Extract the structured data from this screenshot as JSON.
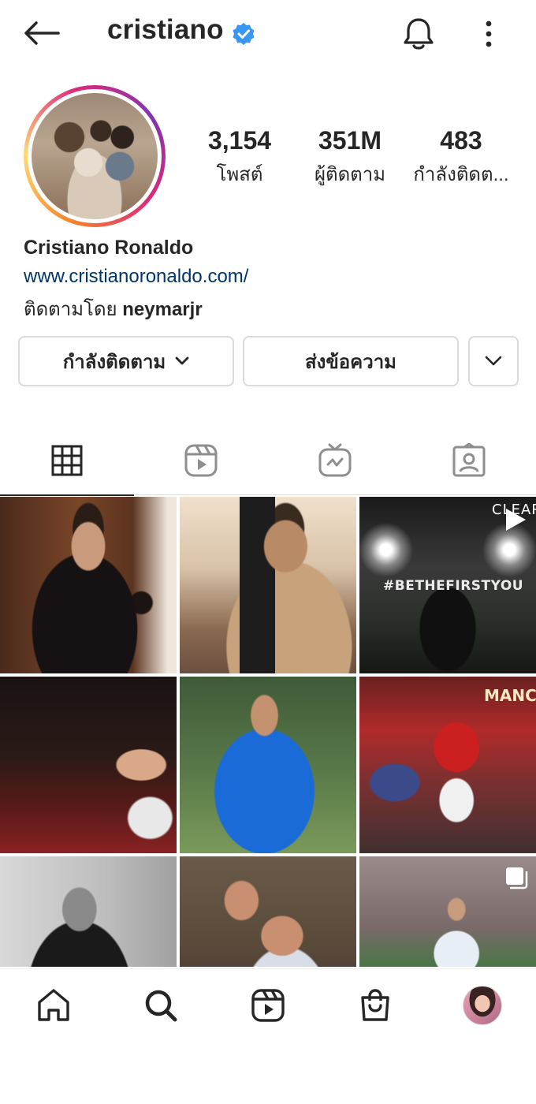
{
  "header": {
    "username": "cristiano",
    "verified": true,
    "icons": [
      "back-arrow-icon",
      "verified-badge-icon",
      "bell-icon",
      "more-vertical-icon"
    ]
  },
  "profile": {
    "stats": {
      "posts": {
        "value": "3,154",
        "label": "โพสต์"
      },
      "followers": {
        "value": "351M",
        "label": "ผู้ติดตาม"
      },
      "following": {
        "value": "483",
        "label": "กำลังติดต..."
      }
    },
    "full_name": "Cristiano Ronaldo",
    "website": "www.cristianoronaldo.com/",
    "followed_by_prefix": "ติดตามโดย",
    "followed_by_user": "neymarjr"
  },
  "actions": {
    "following_label": "กำลังติดตาม",
    "message_label": "ส่งข้อความ"
  },
  "tabs": [
    {
      "name": "posts-grid",
      "icon": "grid-icon",
      "active": true
    },
    {
      "name": "reels",
      "icon": "reels-icon",
      "active": false
    },
    {
      "name": "igtv",
      "icon": "igtv-icon",
      "active": false
    },
    {
      "name": "tagged",
      "icon": "tagged-user-icon",
      "active": false
    }
  ],
  "grid": {
    "overlays": {
      "post3_brand": "CLEAR",
      "post3_hashtag": "#BETHEFIRSTYOU",
      "post6_brand": "MANCH"
    },
    "badges": {
      "post3": "reel-play-icon",
      "post9": "carousel-icon"
    }
  },
  "bottom_nav": [
    "home-icon",
    "search-icon",
    "reels-icon",
    "shop-icon",
    "profile-avatar"
  ],
  "colors": {
    "text": "#262626",
    "link": "#00376b",
    "verified": "#3897f0",
    "border": "#dbdbdb"
  }
}
